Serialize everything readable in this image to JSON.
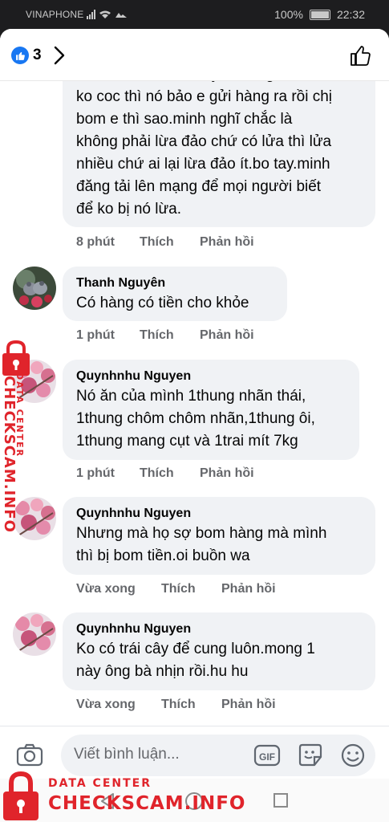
{
  "status_bar": {
    "carrier": "VINAPHONE",
    "battery": "100%",
    "time": "22:32"
  },
  "header": {
    "reaction_count": "3"
  },
  "comments": [
    {
      "name": "",
      "lines": [
        "chờ hàn rồi hàn chuyển hàng, nếu e",
        "ko coc thì nó bảo e gửi hàng ra rồi chị",
        "bom e thì sao.minh nghĩ chắc là",
        "không phải lừa đảo chứ có lửa thì lửa",
        "nhiều chứ ai lại lừa đảo ít.bo tay.minh",
        "đăng tải lên mạng để mọi người biết",
        "để ko bị nó lừa."
      ],
      "time": "8 phút",
      "like": "Thích",
      "reply": "Phản hồi"
    },
    {
      "name": "Thanh Nguyên",
      "lines": [
        "Có hàng có tiền cho khỏe"
      ],
      "time": "1 phút",
      "like": "Thích",
      "reply": "Phản hồi"
    },
    {
      "name": "Quynhnhu Nguyen",
      "lines": [
        "Nó ăn của mình 1thung nhãn thái,",
        "1thung chôm chôm nhãn,1thung ôi,",
        "1thung mang cụt và 1trai mít 7kg"
      ],
      "time": "1 phút",
      "like": "Thích",
      "reply": "Phản hồi"
    },
    {
      "name": "Quynhnhu Nguyen",
      "lines": [
        "Nhưng mà họ sợ bom hàng mà mình",
        "thì bị bom tiền.oi buồn wa"
      ],
      "time": "Vừa xong",
      "like": "Thích",
      "reply": "Phản hồi"
    },
    {
      "name": "Quynhnhu Nguyen",
      "lines": [
        "Ko có trái cây để cung luôn.mong 1",
        "này ông bà nhịn rồi.hu hu"
      ],
      "time": "Vừa xong",
      "like": "Thích",
      "reply": "Phản hồi"
    }
  ],
  "composer": {
    "placeholder": "Viết bình luận...",
    "gif_label": "GIF"
  },
  "watermark": {
    "line1": "DATA CENTER",
    "line2": "CHECKSCAM.INFO"
  },
  "colors": {
    "facebook_blue": "#1877f2",
    "watermark_red": "#e0242b",
    "bubble_bg": "#f0f2f5",
    "meta_gray": "#65676b"
  }
}
